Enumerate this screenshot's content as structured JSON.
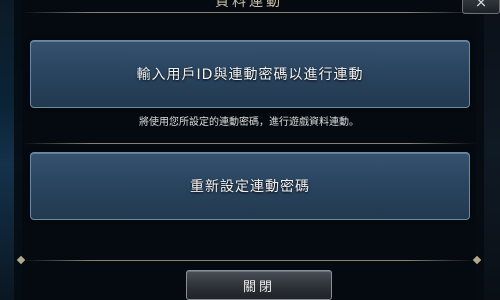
{
  "dialog": {
    "title": "資料連動",
    "close_icon": "×",
    "input_id_button_label": "輸入用戶ID與連動密碼以進行連動",
    "description": "將使用您所設定的連動密碼，進行遊戲資料連動。",
    "reset_password_button_label": "重新設定連動密碼",
    "close_button_label": "關閉"
  }
}
